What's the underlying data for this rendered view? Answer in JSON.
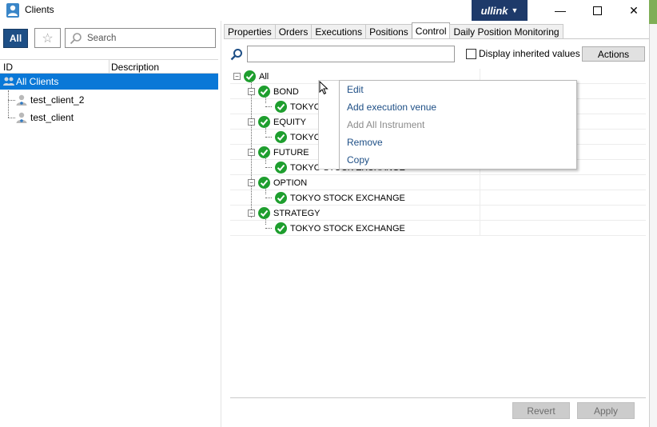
{
  "window": {
    "title": "Clients",
    "brand": "ullink"
  },
  "left": {
    "all_button": "All",
    "search_placeholder": "Search",
    "columns": [
      "ID",
      "Description"
    ],
    "tree": [
      "All Clients",
      "test_client_2",
      "test_client"
    ]
  },
  "tabs": [
    "Properties",
    "Orders",
    "Executions",
    "Positions",
    "Control",
    "Daily Position Monitoring"
  ],
  "active_tab": "Control",
  "control": {
    "display_inherited_label": "Display inherited values",
    "display_inherited_checked": false,
    "actions_label": "Actions",
    "tree": {
      "root": "All",
      "groups": [
        {
          "name": "BOND",
          "child": "TOKYO"
        },
        {
          "name": "EQUITY",
          "child": "TOKYO"
        },
        {
          "name": "FUTURE",
          "child": "TOKYO STOCK EXCHANGE"
        },
        {
          "name": "OPTION",
          "child": "TOKYO STOCK EXCHANGE"
        },
        {
          "name": "STRATEGY",
          "child": "TOKYO STOCK EXCHANGE"
        }
      ]
    }
  },
  "context_menu": [
    {
      "label": "Edit",
      "enabled": true
    },
    {
      "label": "Add execution venue",
      "enabled": true
    },
    {
      "label": "Add All Instrument",
      "enabled": false
    },
    {
      "label": "Remove",
      "enabled": true
    },
    {
      "label": "Copy",
      "enabled": true
    }
  ],
  "footer": {
    "revert": "Revert",
    "apply": "Apply"
  },
  "colors": {
    "accent": "#1e4f86",
    "selection": "#0a78d7",
    "check": "#1e9e2e",
    "brand_bg": "#1e3a6a"
  }
}
